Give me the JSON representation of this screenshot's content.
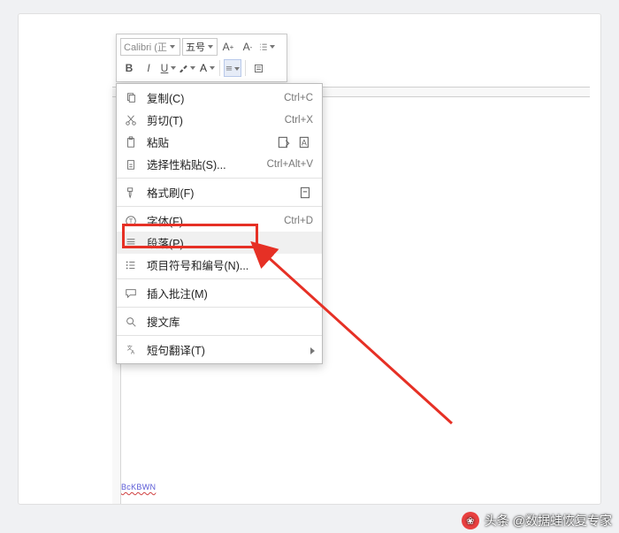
{
  "toolbar": {
    "font_name": "Calibri (正",
    "font_size": "五号"
  },
  "menu": {
    "copy": {
      "label": "复制(C)",
      "shortcut": "Ctrl+C"
    },
    "cut": {
      "label": "剪切(T)",
      "shortcut": "Ctrl+X"
    },
    "paste": {
      "label": "粘贴"
    },
    "paste_sp": {
      "label": "选择性粘贴(S)...",
      "shortcut": "Ctrl+Alt+V"
    },
    "painter": {
      "label": "格式刷(F)"
    },
    "font": {
      "label": "字体(F)...",
      "shortcut": "Ctrl+D"
    },
    "paragraph": {
      "label": "段落(P)..."
    },
    "bullets": {
      "label": "项目符号和编号(N)..."
    },
    "comment": {
      "label": "插入批注(M)"
    },
    "soulib": {
      "label": "搜文库"
    },
    "translate": {
      "label": "短句翻译(T)"
    }
  },
  "doc_mark": "BcKBWN",
  "watermark": "头条 @数据蛙恢复专家"
}
